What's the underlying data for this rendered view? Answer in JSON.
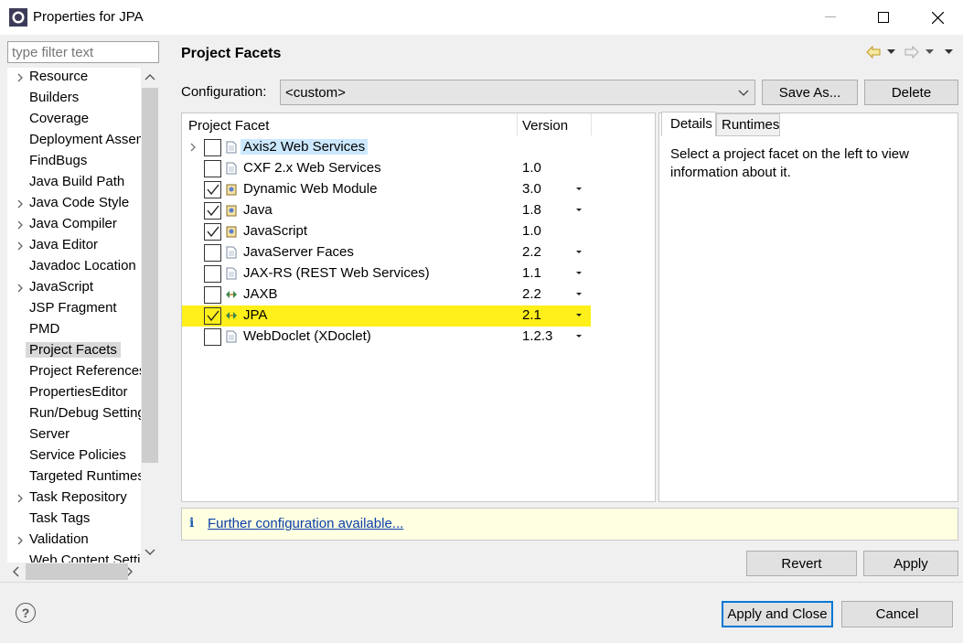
{
  "window": {
    "title": "Properties for JPA",
    "minimize_icon": "minimize-icon",
    "maximize_icon": "maximize-icon",
    "close_icon": "close-icon"
  },
  "sidebar": {
    "filter_placeholder": "type filter text",
    "items": [
      {
        "label": "Resource",
        "expandable": true
      },
      {
        "label": "Builders",
        "expandable": false
      },
      {
        "label": "Coverage",
        "expandable": false
      },
      {
        "label": "Deployment Assembly",
        "expandable": false
      },
      {
        "label": "FindBugs",
        "expandable": false
      },
      {
        "label": "Java Build Path",
        "expandable": false
      },
      {
        "label": "Java Code Style",
        "expandable": true
      },
      {
        "label": "Java Compiler",
        "expandable": true
      },
      {
        "label": "Java Editor",
        "expandable": true
      },
      {
        "label": "Javadoc Location",
        "expandable": false
      },
      {
        "label": "JavaScript",
        "expandable": true
      },
      {
        "label": "JSP Fragment",
        "expandable": false
      },
      {
        "label": "PMD",
        "expandable": false
      },
      {
        "label": "Project Facets",
        "expandable": false,
        "selected": true
      },
      {
        "label": "Project References",
        "expandable": false
      },
      {
        "label": "PropertiesEditor",
        "expandable": false
      },
      {
        "label": "Run/Debug Settings",
        "expandable": false
      },
      {
        "label": "Server",
        "expandable": false
      },
      {
        "label": "Service Policies",
        "expandable": false
      },
      {
        "label": "Targeted Runtimes",
        "expandable": false
      },
      {
        "label": "Task Repository",
        "expandable": true
      },
      {
        "label": "Task Tags",
        "expandable": false
      },
      {
        "label": "Validation",
        "expandable": true
      },
      {
        "label": "Web Content Settings",
        "expandable": false
      }
    ]
  },
  "main": {
    "title": "Project Facets",
    "config_label": "Configuration:",
    "config_value": "<custom>",
    "save_as_label": "Save As...",
    "delete_label": "Delete",
    "columns": {
      "facet": "Project Facet",
      "version": "Version"
    },
    "facets": [
      {
        "name": "Axis2 Web Services",
        "version": "",
        "checked": false,
        "dropdown": false,
        "icon": "page-icon",
        "expandable": true,
        "selected": true
      },
      {
        "name": "CXF 2.x Web Services",
        "version": "1.0",
        "checked": false,
        "dropdown": false,
        "icon": "page-icon"
      },
      {
        "name": "Dynamic Web Module",
        "version": "3.0",
        "checked": true,
        "dropdown": true,
        "icon": "web-module-icon"
      },
      {
        "name": "Java",
        "version": "1.8",
        "checked": true,
        "dropdown": true,
        "icon": "java-facet-icon"
      },
      {
        "name": "JavaScript",
        "version": "1.0",
        "checked": true,
        "dropdown": false,
        "icon": "javascript-facet-icon"
      },
      {
        "name": "JavaServer Faces",
        "version": "2.2",
        "checked": false,
        "dropdown": true,
        "icon": "page-icon"
      },
      {
        "name": "JAX-RS (REST Web Services)",
        "version": "1.1",
        "checked": false,
        "dropdown": true,
        "icon": "page-icon"
      },
      {
        "name": "JAXB",
        "version": "2.2",
        "checked": false,
        "dropdown": true,
        "icon": "jaxb-icon"
      },
      {
        "name": "JPA",
        "version": "2.1",
        "checked": true,
        "dropdown": true,
        "icon": "jpa-icon",
        "highlight": true
      },
      {
        "name": "WebDoclet (XDoclet)",
        "version": "1.2.3",
        "checked": false,
        "dropdown": true,
        "icon": "page-icon"
      }
    ],
    "tabs": {
      "details": "Details",
      "runtimes": "Runtimes"
    },
    "details_text": "Select a project facet on the left to view information about it.",
    "info_icon": "i",
    "info_link": "Further configuration available...",
    "revert_label": "Revert",
    "apply_label": "Apply"
  },
  "footer": {
    "help_icon": "?",
    "apply_close_label": "Apply and Close",
    "cancel_label": "Cancel"
  },
  "colors": {
    "highlight": "#ffef1a",
    "selection": "#cce8ff",
    "info_bg": "#ffffe1",
    "link": "#0b3fa8"
  }
}
